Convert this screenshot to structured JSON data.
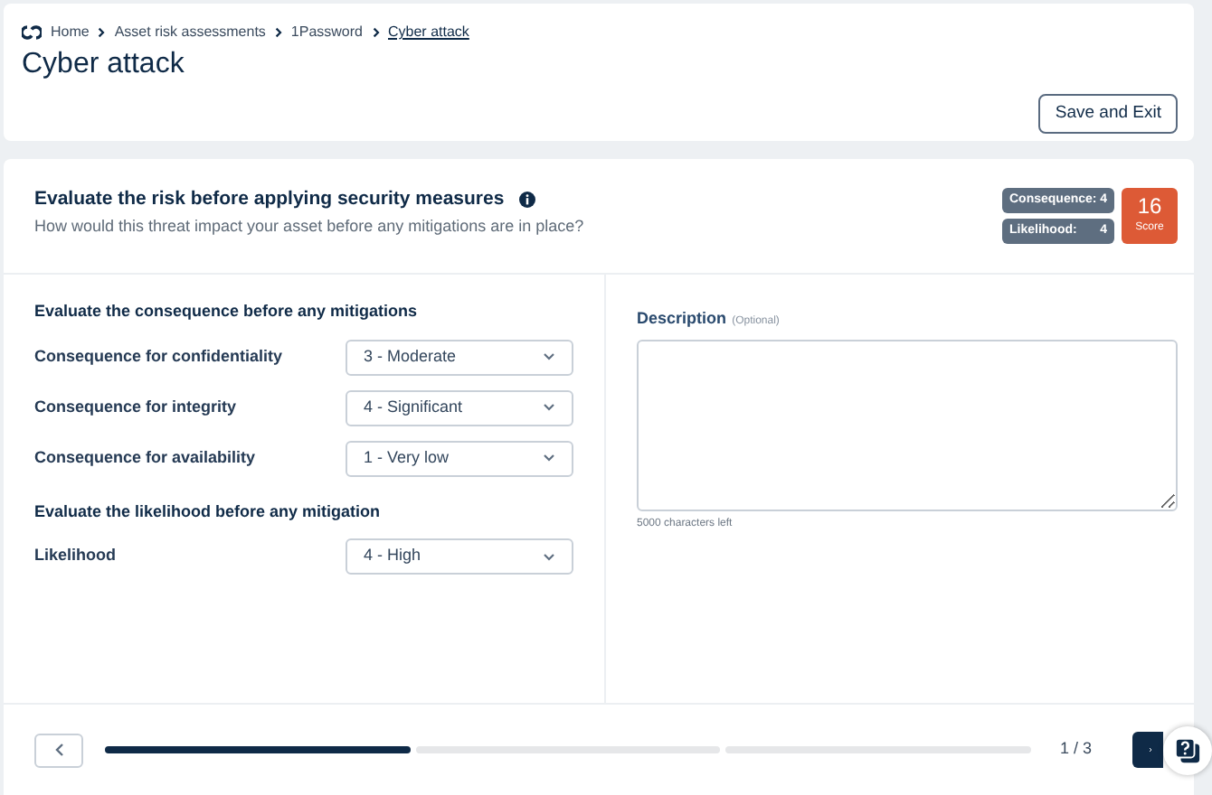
{
  "breadcrumb": [
    {
      "label": "Home",
      "current": false
    },
    {
      "label": "Asset risk assessments",
      "current": false
    },
    {
      "label": "1Password",
      "current": false
    },
    {
      "label": "Cyber attack",
      "current": true
    }
  ],
  "page_title": "Cyber attack",
  "save_button": "Save and Exit",
  "evaluation": {
    "title": "Evaluate the risk before applying security measures",
    "subtitle": "How would this threat impact your asset before any mitigations are in place?",
    "badges": [
      {
        "label": "Consequence:",
        "value": "4"
      },
      {
        "label": "Likelihood:",
        "value": "4"
      }
    ],
    "score": {
      "value": "16",
      "label": "Score"
    }
  },
  "sections": [
    {
      "heading": "Evaluate the consequence before any mitigations",
      "fields": [
        {
          "label": "Consequence for confidentiality",
          "value": "3 - Moderate"
        },
        {
          "label": "Consequence for integrity",
          "value": "4 - Significant"
        },
        {
          "label": "Consequence for availability",
          "value": "1 - Very low"
        }
      ]
    },
    {
      "heading": "Evaluate the likelihood before any mitigation",
      "fields": [
        {
          "label": "Likelihood",
          "value": "4 - High"
        }
      ]
    }
  ],
  "description": {
    "label": "Description",
    "hint": "(Optional)",
    "counter": "5000 characters left"
  },
  "progress": {
    "steps": [
      {
        "completed": true
      },
      {
        "completed": false
      },
      {
        "completed": false
      }
    ],
    "text": "1 / 3"
  }
}
